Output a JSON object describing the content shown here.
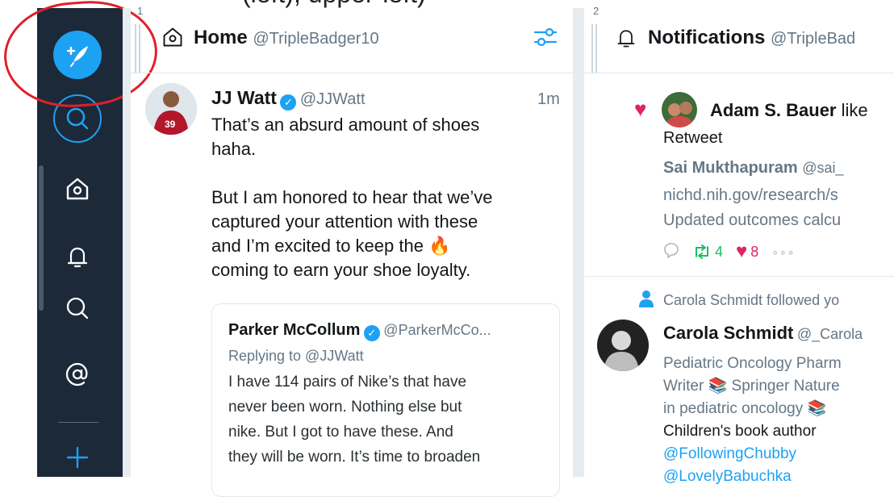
{
  "caption_top": "(left), upper-left)",
  "nav": {
    "compose_icon": "compose-tweet-icon",
    "items": [
      {
        "name": "search",
        "icon": "search-icon"
      },
      {
        "name": "home",
        "icon": "home-icon"
      },
      {
        "name": "notifications",
        "icon": "bell-icon"
      },
      {
        "name": "search2",
        "icon": "search-icon"
      },
      {
        "name": "mentions",
        "icon": "at-icon"
      },
      {
        "name": "add-column",
        "icon": "plus-icon"
      }
    ]
  },
  "columns": [
    {
      "number": "1",
      "title": "Home",
      "handle": "@TripleBadger10",
      "tweet": {
        "name": "JJ Watt",
        "handle": "@JJWatt",
        "time": "1m",
        "text_lines": [
          "That’s an absurd amount of shoes",
          "haha.",
          "",
          "But I am honored to hear that we’ve",
          "captured your attention with these",
          "and I’m excited to keep the 🔥",
          " coming to earn your shoe loyalty."
        ],
        "quote": {
          "name": "Parker McCollum",
          "handle": "@ParkerMcCo...",
          "reply_to": "Replying to @JJWatt",
          "text_lines": [
            "I have 114 pairs of Nike’s that have",
            "never been worn. Nothing else but",
            "nike. But I got to have these. And",
            "they will be worn. It’s time to broaden"
          ]
        }
      }
    },
    {
      "number": "2",
      "title": "Notifications",
      "handle": "@TripleBad",
      "like_item": {
        "user": "Adam S. Bauer",
        "action": "like",
        "type_label": "Retweet",
        "original_user": "Sai Mukthapuram",
        "original_handle": "@sai_",
        "lines": [
          "nichd.nih.gov/research/s",
          "Updated outcomes calcu"
        ],
        "retweets": "4",
        "likes": "8"
      },
      "follow_item": {
        "banner": "Carola Schmidt followed yo",
        "name": "Carola Schmidt",
        "handle": "@_Carola",
        "bio_lines": [
          "Pediatric Oncology Pharm",
          "Writer 📚 Springer Nature",
          "in pediatric oncology 📚",
          "Children's book author"
        ],
        "link1": "@FollowingChubby",
        "link2": "@LovelyBabuchka"
      }
    }
  ]
}
